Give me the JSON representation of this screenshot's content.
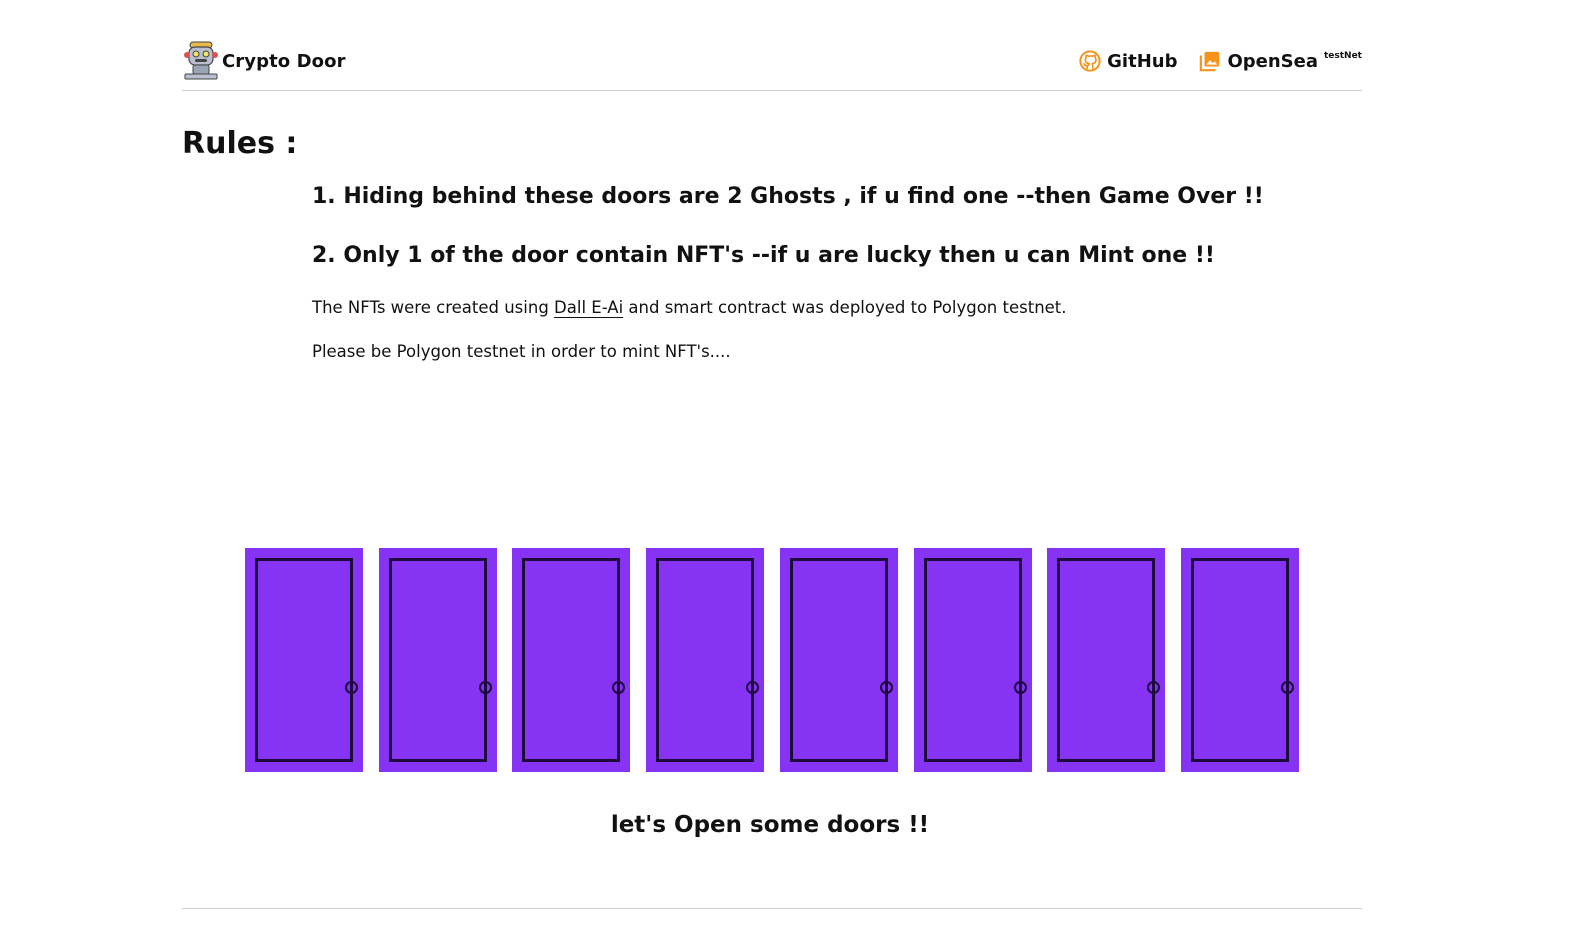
{
  "header": {
    "brand_name": "Crypto Door",
    "brand_icon": "robot-logo-icon",
    "nav": [
      {
        "label": "GitHub",
        "icon": "github-icon",
        "icon_color": "#f7931a"
      },
      {
        "label": "OpenSea",
        "icon": "image-gallery-icon",
        "icon_color": "#f7931a",
        "sup": "testNet"
      }
    ]
  },
  "rules": {
    "title": "Rules :",
    "items": [
      "1. Hiding behind these doors are 2 Ghosts , if u find one --then Game Over !!",
      "2. Only 1 of the door contain NFT's --if u are lucky then u can Mint one !!"
    ],
    "para1_before": "The NFTs were created using ",
    "para1_link": "Dall E-Ai",
    "para1_after": " and smart contract was deployed to Polygon testnet.",
    "para2": "Please be Polygon testnet in order to mint NFT's...."
  },
  "doors": {
    "count": 8,
    "door_color": "#8733f3",
    "outline_color": "#1c0a3a"
  },
  "cta": "let's Open some doors !!"
}
